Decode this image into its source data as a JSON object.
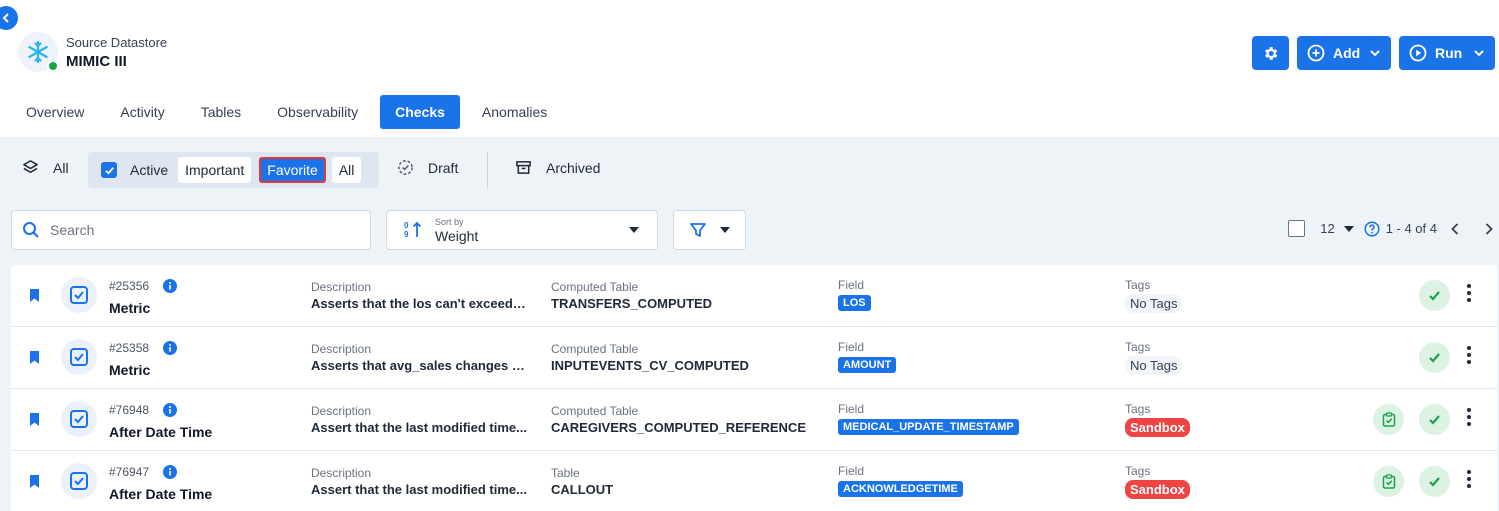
{
  "header": {
    "subtitle": "Source Datastore",
    "title": "MIMIC III"
  },
  "actions": {
    "add_label": "Add",
    "run_label": "Run"
  },
  "tabs": [
    {
      "label": "Overview",
      "active": false
    },
    {
      "label": "Activity",
      "active": false
    },
    {
      "label": "Tables",
      "active": false
    },
    {
      "label": "Observability",
      "active": false
    },
    {
      "label": "Checks",
      "active": true
    },
    {
      "label": "Anomalies",
      "active": false
    }
  ],
  "filters": {
    "all_label": "All",
    "active_label": "Active",
    "active_checked": true,
    "important_label": "Important",
    "favorite_label": "Favorite",
    "favorite_selected": true,
    "active_all_label": "All",
    "draft_label": "Draft",
    "archived_label": "Archived"
  },
  "search": {
    "placeholder": "Search"
  },
  "sort": {
    "label": "Sort by",
    "value": "Weight"
  },
  "pagination": {
    "page_size": "12",
    "range": "1 - 4 of 4"
  },
  "colors": {
    "accent": "#1a73e8",
    "success": "#16a34a",
    "danger": "#ef4444",
    "highlight_border": "#e53935"
  },
  "columns": {
    "description": "Description",
    "field": "Field",
    "tags": "Tags"
  },
  "checks": [
    {
      "id": "#25356",
      "type": "Metric",
      "description": "Asserts that the los can't exceed t...",
      "table_label": "Computed Table",
      "table": "TRANSFERS_COMPUTED",
      "field": "LOS",
      "tag": "No Tags",
      "tag_style": "none",
      "has_extra_status": false
    },
    {
      "id": "#25358",
      "type": "Metric",
      "description": "Asserts that avg_sales changes b...",
      "table_label": "Computed Table",
      "table": "INPUTEVENTS_CV_COMPUTED",
      "field": "AMOUNT",
      "tag": "No Tags",
      "tag_style": "none",
      "has_extra_status": false
    },
    {
      "id": "#76948",
      "type": "After Date Time",
      "description": "Assert that the last modified time...",
      "table_label": "Computed Table",
      "table": "CAREGIVERS_COMPUTED_REFERENCE",
      "field": "MEDICAL_UPDATE_TIMESTAMP",
      "tag": "Sandbox",
      "tag_style": "sandbox",
      "has_extra_status": true
    },
    {
      "id": "#76947",
      "type": "After Date Time",
      "description": "Assert that the last modified time...",
      "table_label": "Table",
      "table": "CALLOUT",
      "field": "ACKNOWLEDGETIME",
      "tag": "Sandbox",
      "tag_style": "sandbox",
      "has_extra_status": true
    }
  ]
}
